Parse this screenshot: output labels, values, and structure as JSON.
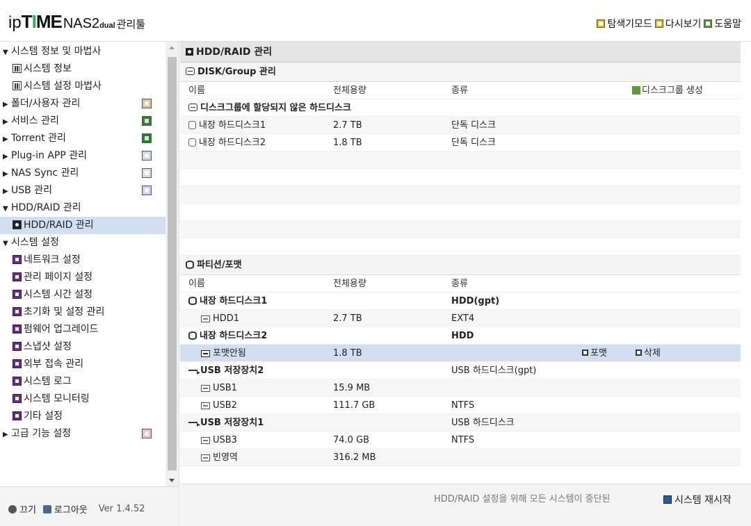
{
  "header": {
    "logo_ip": "ip",
    "logo_time_t": "T",
    "logo_time_i": "I",
    "logo_time_me": "ME",
    "logo_model": "NAS2",
    "logo_dual": "dual",
    "logo_sub": "관리툴",
    "links": [
      {
        "label": "탐색기모드",
        "icon": "explorer-icon"
      },
      {
        "label": "다시보기",
        "icon": "refresh-icon"
      },
      {
        "label": "도움말",
        "icon": "help-icon"
      }
    ]
  },
  "sidebar": {
    "items": [
      {
        "label": "시스템 정보 및 마법사",
        "type": "group",
        "expanded": true
      },
      {
        "label": "시스템 정보",
        "type": "sub",
        "icon": "bar-chart-icon"
      },
      {
        "label": "시스템 설정 마법사",
        "type": "sub",
        "icon": "bar-chart-icon"
      },
      {
        "label": "폴더/사용자 관리",
        "type": "group",
        "expanded": false,
        "right_icon": "folder-user-icon"
      },
      {
        "label": "서비스 관리",
        "type": "group",
        "expanded": false,
        "right_icon": "service-icon"
      },
      {
        "label": "Torrent 관리",
        "type": "group",
        "expanded": false,
        "right_icon": "torrent-icon"
      },
      {
        "label": "Plug-in APP 관리",
        "type": "group",
        "expanded": false,
        "right_icon": "plugin-icon"
      },
      {
        "label": "NAS Sync 관리",
        "type": "group",
        "expanded": false,
        "right_icon": "sync-icon"
      },
      {
        "label": "USB 관리",
        "type": "group",
        "expanded": false,
        "right_icon": "usb-icon"
      },
      {
        "label": "HDD/RAID 관리",
        "type": "group",
        "expanded": true
      },
      {
        "label": "HDD/RAID 관리",
        "type": "sub",
        "icon": "hdd-icon",
        "active": true
      },
      {
        "label": "시스템 설정",
        "type": "group",
        "expanded": true
      },
      {
        "label": "네트워크 설정",
        "type": "sub",
        "icon": "settings-icon"
      },
      {
        "label": "관리 페이지 설정",
        "type": "sub",
        "icon": "settings-icon"
      },
      {
        "label": "시스템 시간 설정",
        "type": "sub",
        "icon": "settings-icon"
      },
      {
        "label": "초기화 및 설정 관리",
        "type": "sub",
        "icon": "settings-icon"
      },
      {
        "label": "펌웨어 업그레이드",
        "type": "sub",
        "icon": "settings-icon"
      },
      {
        "label": "스냅샷 설정",
        "type": "sub",
        "icon": "settings-icon"
      },
      {
        "label": "외부 접속 관리",
        "type": "sub",
        "icon": "settings-icon"
      },
      {
        "label": "시스템 로그",
        "type": "sub",
        "icon": "settings-icon"
      },
      {
        "label": "시스템 모니터링",
        "type": "sub",
        "icon": "settings-icon"
      },
      {
        "label": "기타 설정",
        "type": "sub",
        "icon": "settings-icon"
      },
      {
        "label": "고급 기능 설정",
        "type": "group",
        "expanded": false,
        "right_icon": "advanced-icon"
      }
    ],
    "footer": {
      "power_label": "끄기",
      "logout_label": "로그아웃",
      "version": "Ver 1.4.52"
    }
  },
  "main": {
    "title": "HDD/RAID 관리",
    "disk_group": {
      "title": "DISK/Group 관리",
      "headers": [
        "이름",
        "전체용량",
        "종류"
      ],
      "create_label": "디스크그룹 생성",
      "unassigned_label": "디스크그룹에 할당되지 않은 하드디스크",
      "rows": [
        {
          "name": "내장 하드디스크1",
          "size": "2.7 TB",
          "type": "단독 디스크"
        },
        {
          "name": "내장 하드디스크2",
          "size": "1.8 TB",
          "type": "단독 디스크"
        }
      ]
    },
    "partition": {
      "title": "파티션/포맷",
      "headers": [
        "이름",
        "전체용량",
        "종류"
      ],
      "rows": [
        {
          "name": "내장 하드디스크1",
          "size": "",
          "type": "HDD(gpt)",
          "level": 0,
          "kind": "disk"
        },
        {
          "name": "HDD1",
          "size": "2.7 TB",
          "type": "EXT4",
          "level": 1,
          "kind": "partition"
        },
        {
          "name": "내장 하드디스크2",
          "size": "",
          "type": "HDD",
          "level": 0,
          "kind": "disk"
        },
        {
          "name": "포맷안됨",
          "size": "1.8 TB",
          "type": "",
          "level": 1,
          "kind": "partition",
          "selected": true,
          "format_label": "포맷",
          "delete_label": "삭제"
        },
        {
          "name": "USB 저장장치2",
          "size": "",
          "type": "USB 하드디스크(gpt)",
          "level": 0,
          "kind": "usb"
        },
        {
          "name": "USB1",
          "size": "15.9 MB",
          "type": "",
          "level": 1,
          "kind": "partition"
        },
        {
          "name": "USB2",
          "size": "111.7 GB",
          "type": "NTFS",
          "level": 1,
          "kind": "partition"
        },
        {
          "name": "USB 저장장치1",
          "size": "",
          "type": "USB 하드디스크",
          "level": 0,
          "kind": "usb"
        },
        {
          "name": "USB3",
          "size": "74.0 GB",
          "type": "NTFS",
          "level": 1,
          "kind": "partition"
        },
        {
          "name": "빈영역",
          "size": "316.2 MB",
          "type": "",
          "level": 1,
          "kind": "partition"
        }
      ]
    },
    "footer": {
      "note": "HDD/RAID 설정을 위해 모든 시스템이 중단된",
      "restart_label": "시스템 재시작"
    }
  }
}
